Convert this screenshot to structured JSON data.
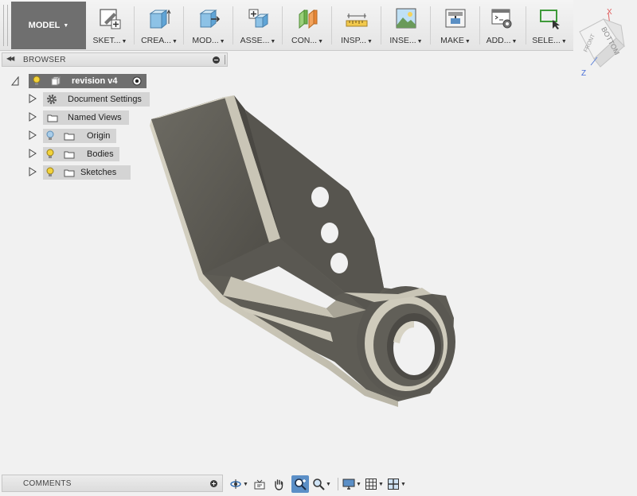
{
  "workspace": {
    "label": "MODEL",
    "caret": "▼"
  },
  "toolbar": {
    "caret": "▼",
    "buttons": [
      {
        "label": "SKET...",
        "icon": "sketch-icon"
      },
      {
        "label": "CREA...",
        "icon": "create-box-icon"
      },
      {
        "label": "MOD...",
        "icon": "modify-icon"
      },
      {
        "label": "ASSE...",
        "icon": "assemble-icon"
      },
      {
        "label": "CON...",
        "icon": "construct-icon"
      },
      {
        "label": "INSP...",
        "icon": "inspect-ruler-icon"
      },
      {
        "label": "INSE...",
        "icon": "insert-image-icon"
      },
      {
        "label": "MAKE",
        "icon": "make-3d-print-icon"
      },
      {
        "label": "ADD...",
        "icon": "addins-icon"
      },
      {
        "label": "SELE...",
        "icon": "select-icon"
      }
    ]
  },
  "viewcube": {
    "face_front": "FRONT",
    "face_bottom": "BOTTOM",
    "axis_x": "X",
    "axis_z": "Z"
  },
  "browser": {
    "title": "BROWSER",
    "root": {
      "label": "revision v4"
    },
    "items": [
      {
        "label": "Document Settings",
        "icon": "gear-icon"
      },
      {
        "label": "Named Views",
        "icon": "folder-icon"
      },
      {
        "label": "Origin",
        "icon": "folder-icon",
        "visibility": "bulb-off"
      },
      {
        "label": "Bodies",
        "icon": "folder-icon",
        "visibility": "bulb-on"
      },
      {
        "label": "Sketches",
        "icon": "folder-icon",
        "visibility": "bulb-on"
      }
    ]
  },
  "comments": {
    "label": "COMMENTS"
  },
  "colors": {
    "accent": "#5b8fc7",
    "bulb_on": "#f2d23b",
    "bulb_off": "#7fb3dd",
    "model_face": "#5e5c55",
    "model_edge": "#c9c5b6"
  }
}
